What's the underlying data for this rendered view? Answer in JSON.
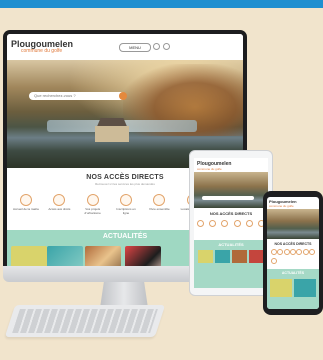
{
  "site": {
    "logo": "Plougoumelen",
    "tagline": "commune du golfe"
  },
  "desktop": {
    "menu_label": "MENU",
    "search_placeholder": "Que recherchez-vous ?",
    "acces_title": "NOS ACCÈS DIRECTS",
    "acces_subtitle": "Retrouvez ici les services les plus demandés",
    "acces_items": [
      {
        "label": "Accueil de la mairie",
        "icon": "building-icon"
      },
      {
        "label": "Accès aux droits",
        "icon": "scale-icon"
      },
      {
        "label": "Vos projets d'urbanisme",
        "icon": "house-icon"
      },
      {
        "label": "Inscriptions en ligne",
        "icon": "pen-icon"
      },
      {
        "label": "Vivre ensemble",
        "icon": "people-icon"
      },
      {
        "label": "Location de salles",
        "icon": "key-icon"
      },
      {
        "label": "Vie locale",
        "icon": "calendar-icon"
      }
    ],
    "news_title": "ACTUALITÉS"
  },
  "tablet": {
    "acces_title": "NOS ACCÈS DIRECTS",
    "news_title": "ACTUALITÉS"
  },
  "phone": {
    "acces_title": "NOS ACCÈS DIRECTS",
    "news_title": "ACTUALITÉS"
  },
  "colors": {
    "accent_orange": "#e4893d",
    "mint": "#9fd8c2",
    "top_bar": "#1f8fd0",
    "background": "#f1e4cc"
  }
}
